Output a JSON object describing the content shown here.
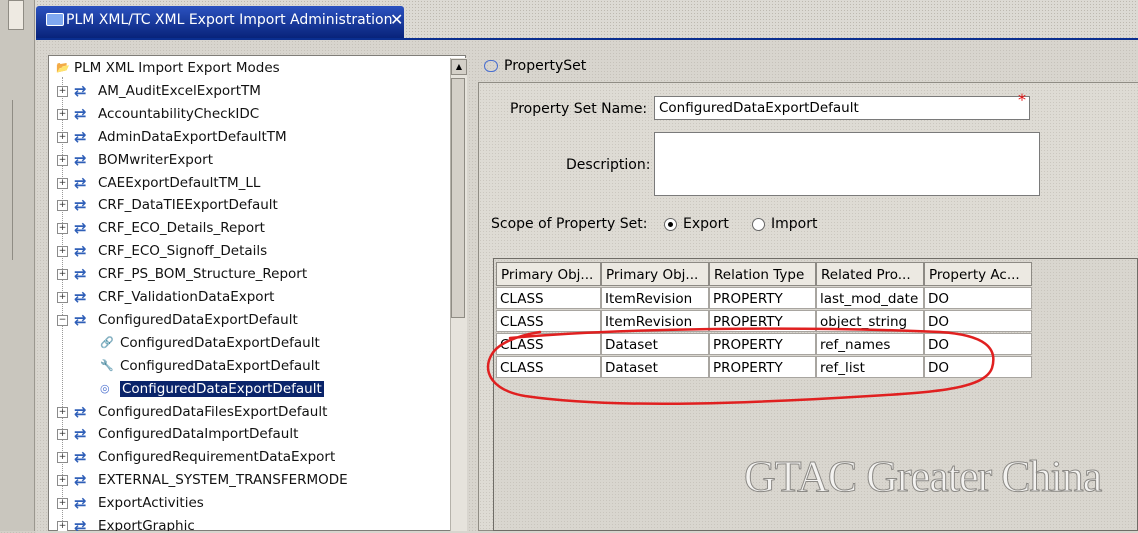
{
  "window": {
    "tab_title": "PLM XML/TC XML Export Import Administration",
    "tab_close": "✕"
  },
  "tree": {
    "root_label": "PLM XML Import Export Modes",
    "items": [
      {
        "label": "AM_AuditExcelExportTM",
        "expander": "+"
      },
      {
        "label": "AccountabilityCheckIDC",
        "expander": "+"
      },
      {
        "label": "AdminDataExportDefaultTM",
        "expander": "+"
      },
      {
        "label": "BOMwriterExport",
        "expander": "+"
      },
      {
        "label": "CAEExportDefaultTM_LL",
        "expander": "+"
      },
      {
        "label": "CRF_DataTIEExportDefault",
        "expander": "+"
      },
      {
        "label": "CRF_ECO_Details_Report",
        "expander": "+"
      },
      {
        "label": "CRF_ECO_Signoff_Details",
        "expander": "+"
      },
      {
        "label": "CRF_PS_BOM_Structure_Report",
        "expander": "+"
      },
      {
        "label": "CRF_ValidationDataExport",
        "expander": "+"
      },
      {
        "label": "ConfiguredDataExportDefault",
        "expander": "−"
      },
      {
        "label": "ConfiguredDataFilesExportDefault",
        "expander": "+"
      },
      {
        "label": "ConfiguredDataImportDefault",
        "expander": "+"
      },
      {
        "label": "ConfiguredRequirementDataExport",
        "expander": "+"
      },
      {
        "label": "EXTERNAL_SYSTEM_TRANSFERMODE",
        "expander": "+"
      },
      {
        "label": "ExportActivities",
        "expander": "+"
      },
      {
        "label": "ExportGraphic",
        "expander": "+"
      }
    ],
    "children": [
      {
        "label": "ConfiguredDataExportDefault",
        "icon": "closure-rule-icon"
      },
      {
        "label": "ConfiguredDataExportDefault",
        "icon": "filter-rule-icon"
      },
      {
        "label": "ConfiguredDataExportDefault",
        "icon": "property-set-icon",
        "selected": true
      }
    ]
  },
  "property_set": {
    "header": "PropertySet",
    "name_label": "Property Set Name:",
    "name_value": "ConfiguredDataExportDefault",
    "required_mark": "*",
    "description_label": "Description:",
    "description_value": "",
    "scope_label": "Scope of Property Set:",
    "scope_options": [
      {
        "label": "Export",
        "selected": true
      },
      {
        "label": "Import",
        "selected": false
      }
    ]
  },
  "table": {
    "columns": [
      "Primary Obj...",
      "Primary Obj...",
      "Relation Type",
      "Related Pro...",
      "Property Ac..."
    ],
    "rows": [
      [
        "CLASS",
        "ItemRevision",
        "PROPERTY",
        "last_mod_date",
        "DO"
      ],
      [
        "CLASS",
        "ItemRevision",
        "PROPERTY",
        "object_string",
        "DO"
      ],
      [
        "CLASS",
        "Dataset",
        "PROPERTY",
        "ref_names",
        "DO"
      ],
      [
        "CLASS",
        "Dataset",
        "PROPERTY",
        "ref_list",
        "DO"
      ]
    ]
  },
  "watermark": "GTAC Greater China",
  "colors": {
    "tab_blue": "#0a2e8f",
    "selection": "#0a246a",
    "annotation_red": "#e02020",
    "arrow_blue": "#2f5fb8"
  }
}
